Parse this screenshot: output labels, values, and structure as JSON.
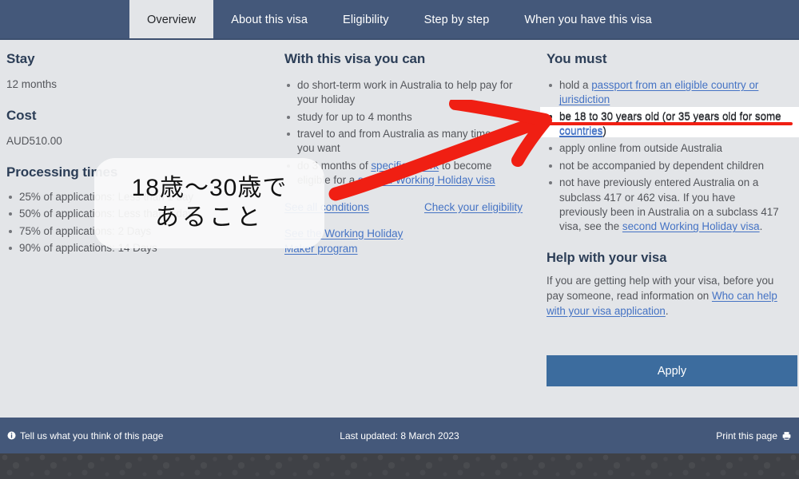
{
  "tabs": [
    {
      "label": "Overview",
      "active": true
    },
    {
      "label": "About this visa",
      "active": false
    },
    {
      "label": "Eligibility",
      "active": false
    },
    {
      "label": "Step by step",
      "active": false
    },
    {
      "label": "When you have this visa",
      "active": false
    }
  ],
  "left": {
    "stay_heading": "Stay",
    "stay_value": "12 months",
    "cost_heading": "Cost",
    "cost_value": "AUD510.00",
    "processing_heading": "Processing times",
    "processing_items": [
      "25% of applications: Less than 1 day",
      "50% of applications: Less than 1 day",
      "75% of applications: 2 Days",
      "90% of applications: 14 Days"
    ]
  },
  "middle": {
    "heading": "With this visa you can",
    "items": [
      {
        "text": "do short-term work in Australia to help pay for your holiday"
      },
      {
        "text": "study for up to 4 months"
      },
      {
        "text": "travel to and from Australia as many times as you want"
      },
      {
        "pre": "do 3 months of ",
        "link1": "specified work",
        "mid": " to become eligible for a ",
        "link2": "second Working Holiday visa",
        "post": ""
      }
    ],
    "link_conditions": "See all conditions",
    "link_eligibility": "Check your eligibility",
    "link_whm": "See the Working Holiday Maker program"
  },
  "right": {
    "heading": "You must",
    "items": [
      {
        "pre": "hold a ",
        "link": "passport from an eligible country or jurisdiction",
        "post": ""
      },
      {
        "pre": "be 18 to 30 years old (or 35 years old for some ",
        "link": "countries",
        "post": ")",
        "highlighted": true
      },
      {
        "pre": "apply online from outside Australia",
        "link": "",
        "post": ""
      },
      {
        "pre": "not be accompanied by dependent children",
        "link": "",
        "post": ""
      },
      {
        "pre": "not have previously entered Australia on a subclass 417 or 462 visa. If you have previously been in Australia on a subclass 417 visa, see the ",
        "link": "second Working Holiday visa",
        "post": "."
      }
    ],
    "help_heading": "Help with your visa",
    "help_pre": "If you are getting help with your visa, before you pay someone, read information on ",
    "help_link": "Who can help with your visa application",
    "help_post": ".",
    "apply_label": "Apply"
  },
  "annotation": {
    "line1": "18歳〜30歳で",
    "line2": "あること",
    "arrow_color": "#f01f13",
    "underline_color": "#f01f13"
  },
  "footer": {
    "feedback": "Tell us what you think of this page",
    "last_updated": "Last updated: 8 March 2023",
    "print": "Print this page"
  },
  "colors": {
    "header_blue": "#44587a",
    "page_bg": "#e3e5e8",
    "link_blue": "#4573c4",
    "button_blue": "#3c6c9e",
    "heading_navy": "#2c3e57",
    "body_gray": "#54565b"
  }
}
